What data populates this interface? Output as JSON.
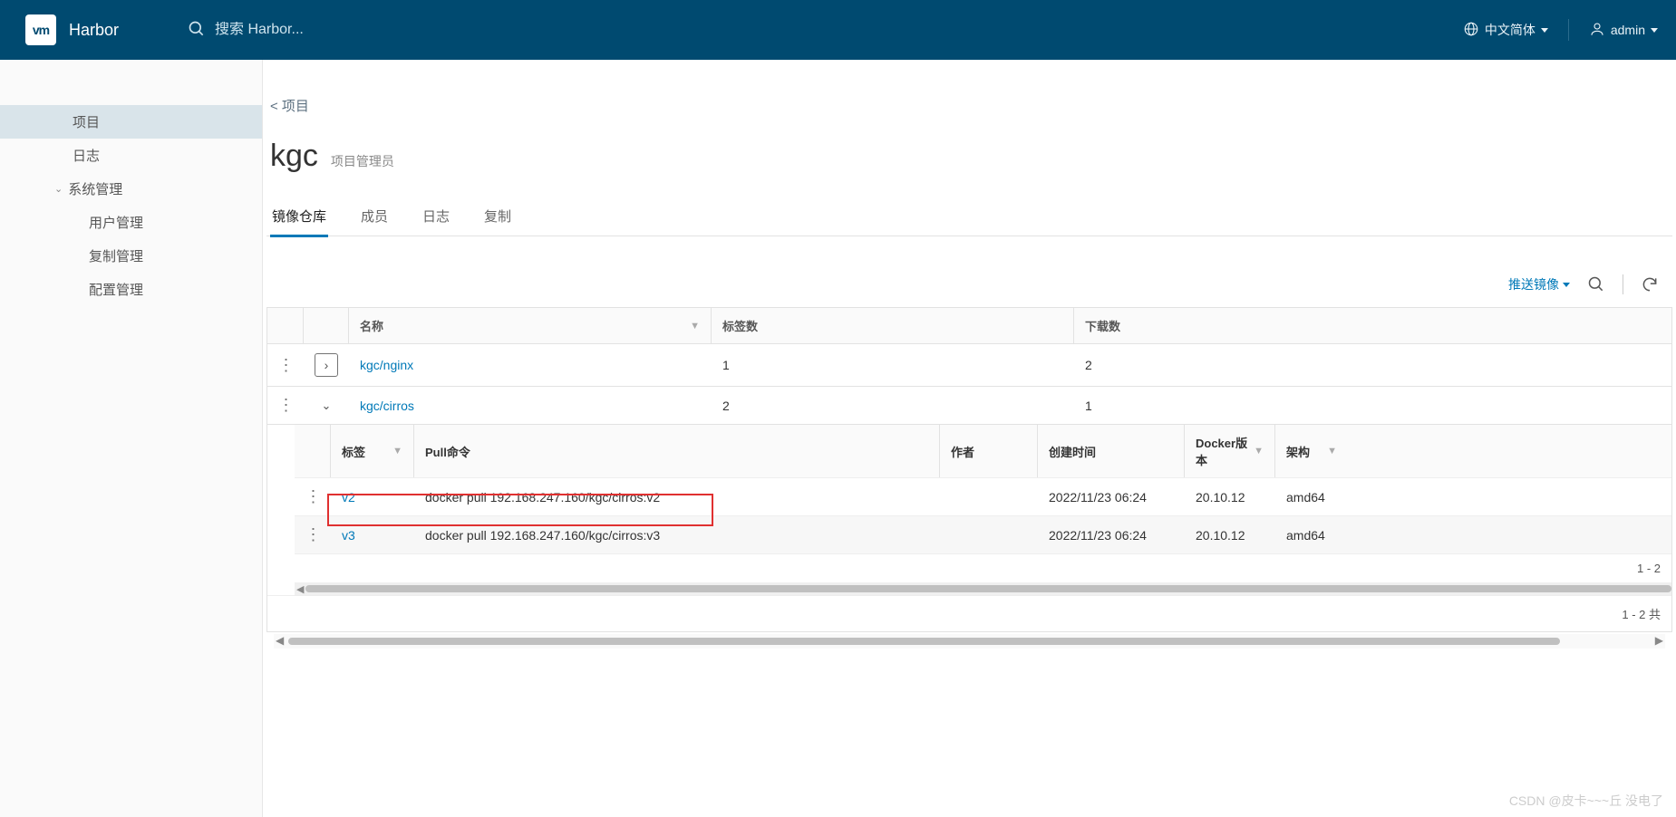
{
  "header": {
    "logo_text": "vm",
    "brand": "Harbor",
    "search_placeholder": "搜索 Harbor...",
    "lang_label": "中文简体",
    "user_label": "admin"
  },
  "sidebar": {
    "projects": "项目",
    "logs": "日志",
    "admin_group": "系统管理",
    "admin_items": [
      "用户管理",
      "复制管理",
      "配置管理"
    ]
  },
  "breadcrumb": "< 项目",
  "project": {
    "name": "kgc",
    "role": "项目管理员"
  },
  "tabs": [
    "镜像仓库",
    "成员",
    "日志",
    "复制"
  ],
  "actions": {
    "push_image": "推送镜像"
  },
  "repos_header": {
    "name": "名称",
    "tags": "标签数",
    "downloads": "下载数"
  },
  "repos": [
    {
      "name": "kgc/nginx",
      "tags": "1",
      "downloads": "2",
      "expanded": false
    },
    {
      "name": "kgc/cirros",
      "tags": "2",
      "downloads": "1",
      "expanded": true
    }
  ],
  "tags_header": {
    "tag": "标签",
    "pull": "Pull命令",
    "author": "作者",
    "created": "创建时间",
    "docker": "Docker版本",
    "arch": "架构"
  },
  "tags": [
    {
      "tag": "v2",
      "pull": "docker pull 192.168.247.160/kgc/cirros:v2",
      "author": "",
      "created": "2022/11/23 06:24",
      "docker": "20.10.12",
      "arch": "amd64"
    },
    {
      "tag": "v3",
      "pull": "docker pull 192.168.247.160/kgc/cirros:v3",
      "author": "",
      "created": "2022/11/23 06:24",
      "docker": "20.10.12",
      "arch": "amd64"
    }
  ],
  "sub_footer": "1 - 2",
  "grid_footer": "1 - 2 共",
  "watermark": "CSDN @皮卡~~~丘 没电了"
}
